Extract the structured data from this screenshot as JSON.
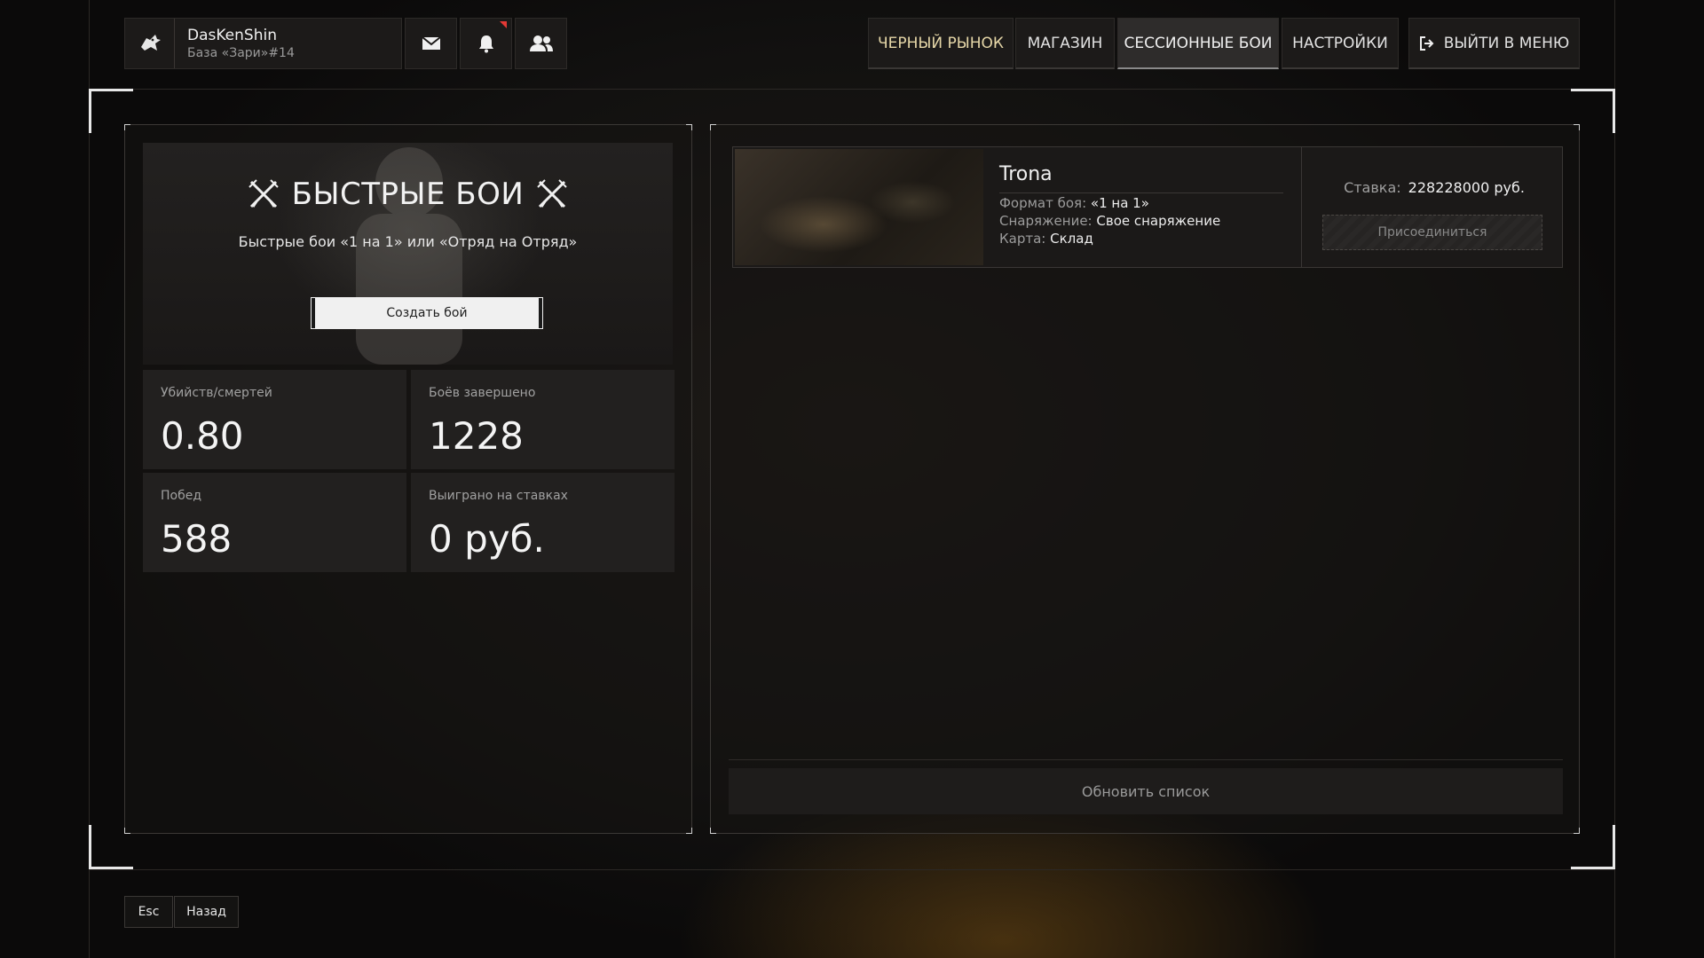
{
  "profile": {
    "nickname": "DasKenShin",
    "base": "База «Зари»#14"
  },
  "top_icons": [
    "mail-icon",
    "bell-icon",
    "friends-icon"
  ],
  "nav": {
    "black_market": "ЧЕРНЫЙ РЫНОК",
    "shop": "МАГАЗИН",
    "session_battles": "СЕССИОННЫЕ БОИ",
    "settings": "НАСТРОЙКИ",
    "exit": "ВЫЙТИ В МЕНЮ",
    "active": "СЕССИОННЫЕ БОИ"
  },
  "quick": {
    "title": "БЫСТРЫЕ БОИ",
    "subtitle": "Быстрые бои «1 на 1» или «Отряд на Отряд»",
    "create_label": "Создать бой"
  },
  "stats": [
    {
      "label": "Убийств/смертей",
      "value": "0.80"
    },
    {
      "label": "Боёв завершено",
      "value": "1228"
    },
    {
      "label": "Побед",
      "value": "588"
    },
    {
      "label": "Выиграно на ставках",
      "value": "0 руб."
    }
  ],
  "lobby": {
    "name": "Trona",
    "format_label": "Формат боя:",
    "format_value": "«1 на 1»",
    "gear_label": "Снаряжение:",
    "gear_value": "Свое снаряжение",
    "map_label": "Карта:",
    "map_value": "Склад",
    "stake_label": "Ставка:",
    "stake_value": "228228000 руб.",
    "join_label": "Присоединиться"
  },
  "refresh_label": "Обновить список",
  "bottom": {
    "esc_key": "Esc",
    "back_label": "Назад"
  },
  "colors": {
    "accent_black_market": "#e6d7a8",
    "notification": "#e53935",
    "background": "#141211"
  }
}
